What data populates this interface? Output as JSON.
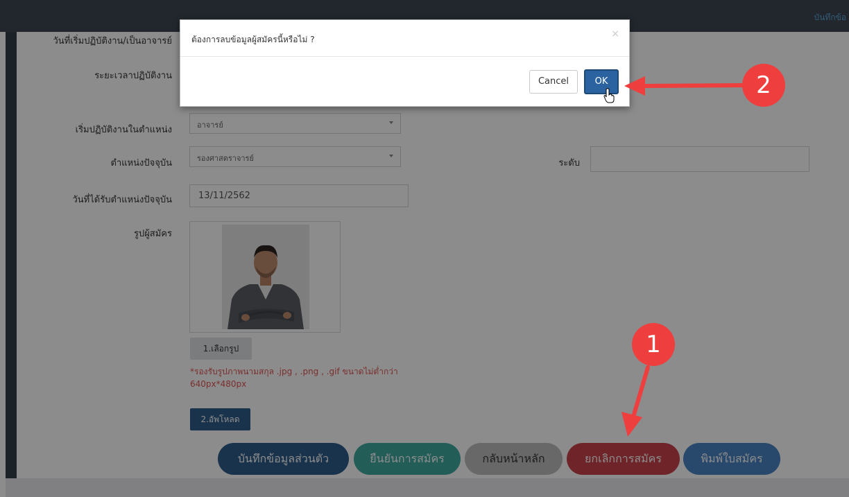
{
  "topbar": {
    "link_text": "บันทึกข้อ"
  },
  "form": {
    "row_start_teaching": {
      "label": "วันที่เริ่มปฏิบัติงาน/เป็นอาจารย์"
    },
    "row_duration": {
      "label": "ระยะเวลาปฏิบัติงาน"
    },
    "row_start_position": {
      "label": "เริ่มปฏิบัติงานในตำแหน่ง",
      "value": "อาจารย์"
    },
    "row_current_position": {
      "label": "ตำแหน่งปัจจุบัน",
      "value": "รองศาสตราจารย์"
    },
    "row_level": {
      "label": "ระดับ",
      "value": ""
    },
    "row_position_date": {
      "label": "วันที่ได้รับตำแหน่งปัจจุบัน",
      "value": "13/11/2562"
    },
    "row_photo": {
      "label": "รูปผู้สมัคร"
    },
    "choose_photo_label": "1.เลือกรูป",
    "hint_text": "*รองรับรูปภาพนามสกุล .jpg , .png , .gif ขนาดไม่ต่ำกว่า 640px*480px",
    "upload_label": "2.อัพโหลด"
  },
  "actions": {
    "save_personal": "บันทึกข้อมูลส่วนตัว",
    "confirm_apply": "ยืนยันการสมัคร",
    "back_home": "กลับหน้าหลัก",
    "cancel_apply": "ยกเลิกการสมัคร",
    "print_form": "พิมพ์ใบสมัคร"
  },
  "modal": {
    "message": "ต้องการลบข้อมูลผู้สมัครนี้หรือไม่ ?",
    "close_symbol": "×",
    "cancel_label": "Cancel",
    "ok_label": "OK"
  },
  "annotations": {
    "badge_1": "1",
    "badge_2": "2"
  },
  "colors": {
    "topbar": "#3c4750",
    "primary": "#2f5d8c",
    "teal": "#3fa9a0",
    "gray": "#bdbdbd",
    "red": "#c8434a",
    "blue_soft": "#4a86c5",
    "marker_red": "#ef3e3e"
  }
}
